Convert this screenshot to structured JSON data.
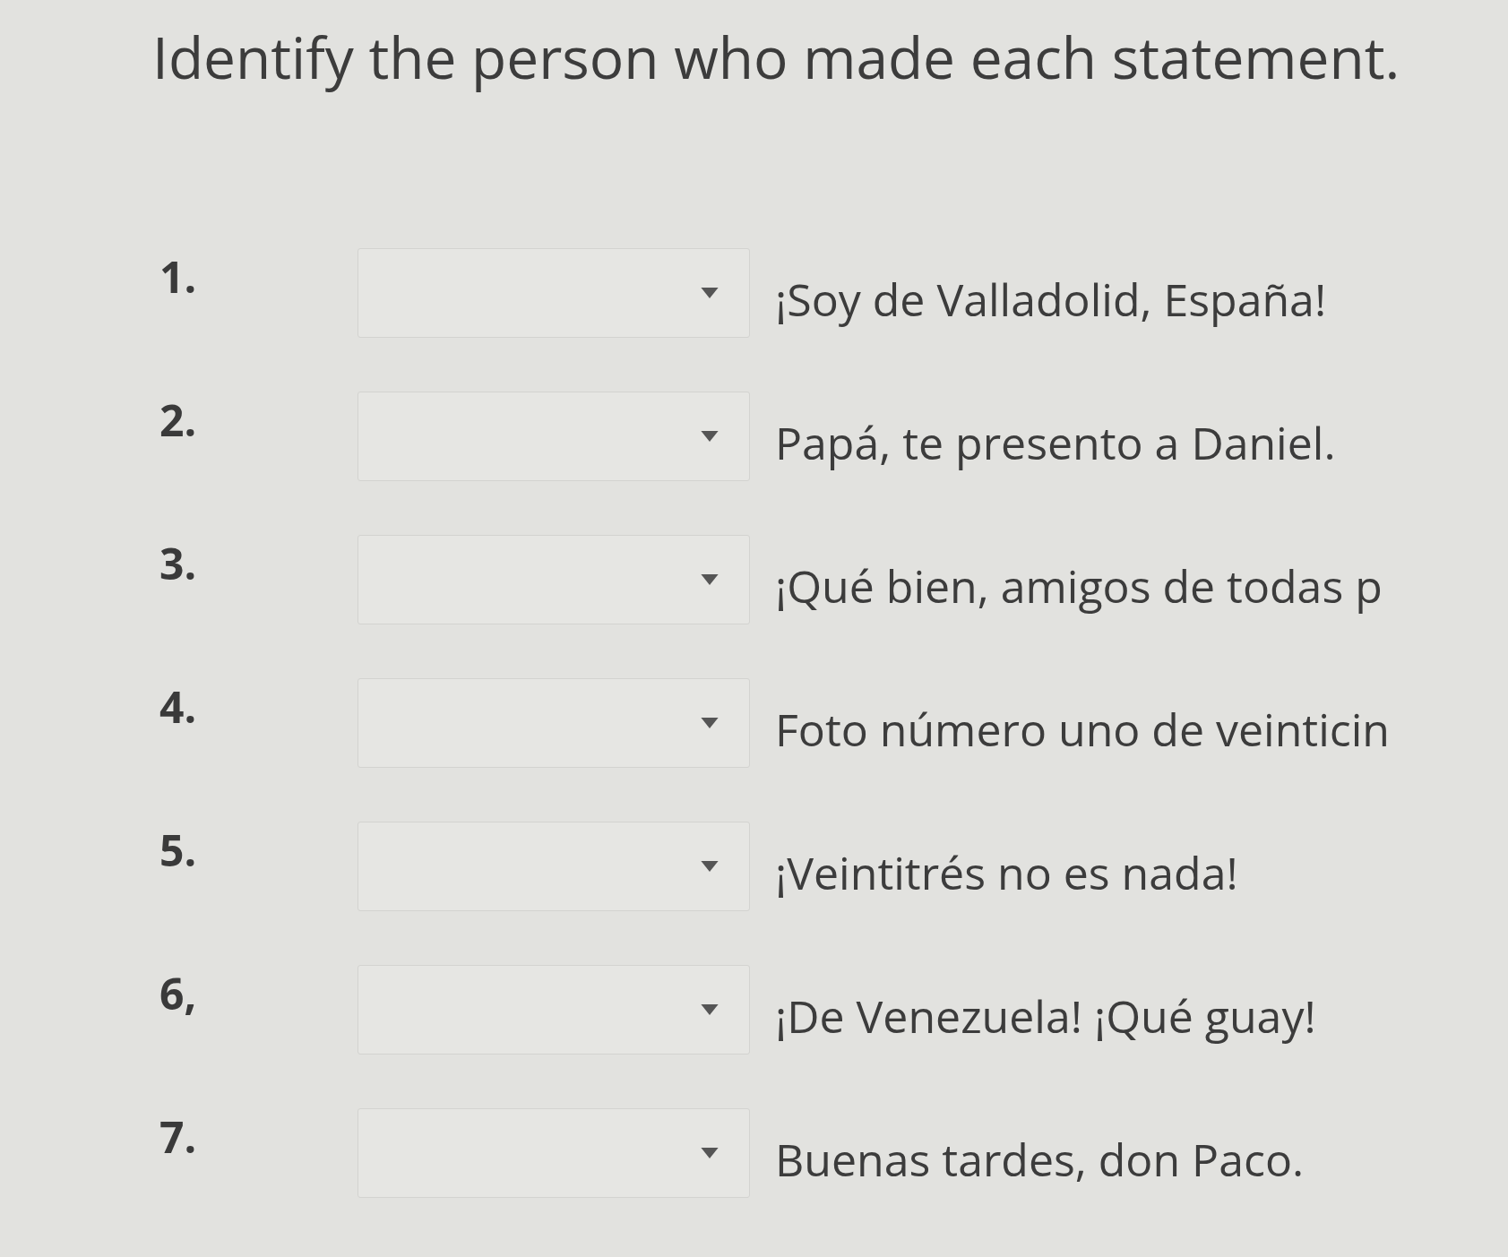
{
  "title": "Identify the person who made each statement.",
  "items": [
    {
      "number": "1.",
      "statement": "¡Soy de Valladolid, España!"
    },
    {
      "number": "2.",
      "statement": "Papá, te presento a Daniel."
    },
    {
      "number": "3.",
      "statement": "¡Qué bien, amigos de todas p"
    },
    {
      "number": "4.",
      "statement": "Foto número uno de veinticin"
    },
    {
      "number": "5.",
      "statement": "¡Veintitrés no es nada!"
    },
    {
      "number": "6,",
      "statement": "¡De Venezuela! ¡Qué guay!"
    },
    {
      "number": "7.",
      "statement": "Buenas tardes, don Paco."
    }
  ]
}
